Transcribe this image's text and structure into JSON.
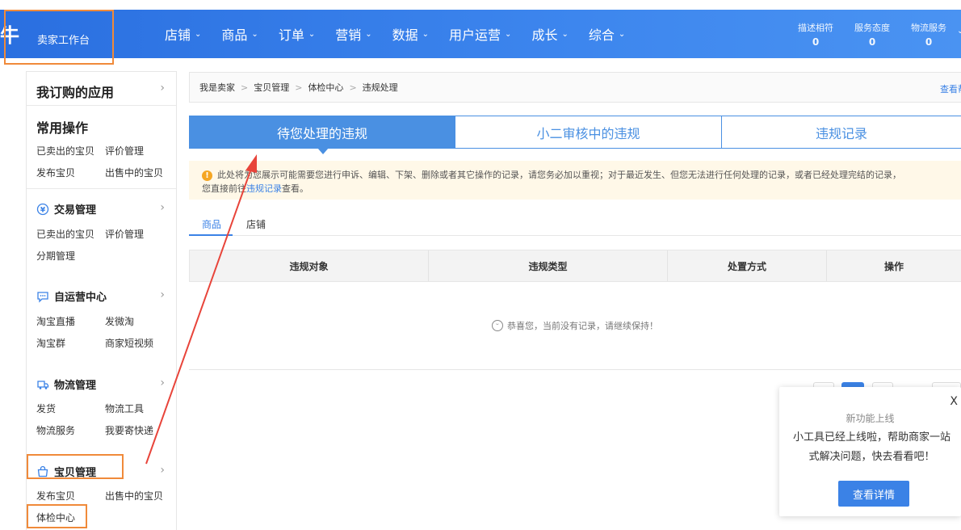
{
  "header": {
    "logo_mark": "牛",
    "logo_text": "卖家工作台",
    "nav": [
      "店铺",
      "商品",
      "订单",
      "营销",
      "数据",
      "用户运营",
      "成长",
      "综合"
    ],
    "scores": [
      {
        "label": "描述相符",
        "value": "0"
      },
      {
        "label": "服务态度",
        "value": "0"
      },
      {
        "label": "物流服务",
        "value": "0"
      }
    ]
  },
  "sidebar": {
    "title": "我订购的应用",
    "common_title": "常用操作",
    "common_links": [
      "已卖出的宝贝",
      "评价管理",
      "发布宝贝",
      "出售中的宝贝"
    ],
    "groups": [
      {
        "name": "交易管理",
        "links": [
          "已卖出的宝贝",
          "评价管理",
          "分期管理"
        ]
      },
      {
        "name": "自运营中心",
        "links": [
          "淘宝直播",
          "发微淘",
          "淘宝群",
          "商家短视频"
        ]
      },
      {
        "name": "物流管理",
        "links": [
          "发货",
          "物流工具",
          "物流服务",
          "我要寄快递"
        ]
      },
      {
        "name": "宝贝管理",
        "links": [
          "发布宝贝",
          "出售中的宝贝",
          "体检中心"
        ]
      }
    ]
  },
  "breadcrumb": [
    "我是卖家",
    "宝贝管理",
    "体检中心",
    "违规处理"
  ],
  "help_link": "查看帮助",
  "tabs": [
    "待您处理的违规",
    "小二审核中的违规",
    "违规记录"
  ],
  "notice": {
    "line1": "此处将为您展示可能需要您进行申诉、编辑、下架、删除或者其它操作的记录，请您务必加以重视；对于最近发生、但您无法进行任何处理的记录，或者已经处理完结的记录，",
    "line2_pre": "您直接前往",
    "line2_link": "违规记录",
    "line2_post": "查看。"
  },
  "subtabs": [
    "商品",
    "店铺"
  ],
  "table": {
    "columns": [
      "违规对象",
      "违规类型",
      "处置方式",
      "操作"
    ],
    "empty_text": "恭喜您，当前没有记录，请继续保持！"
  },
  "popup": {
    "close": "X",
    "title": "新功能上线",
    "body": "小工具已经上线啦，帮助商家一站式解决问题，快去看看吧！",
    "button": "查看详情"
  },
  "colors": {
    "primary": "#3b82e6",
    "header_start": "#2a6fe0",
    "highlight": "#f08a3a",
    "annotation_arrow": "#e8443a"
  }
}
